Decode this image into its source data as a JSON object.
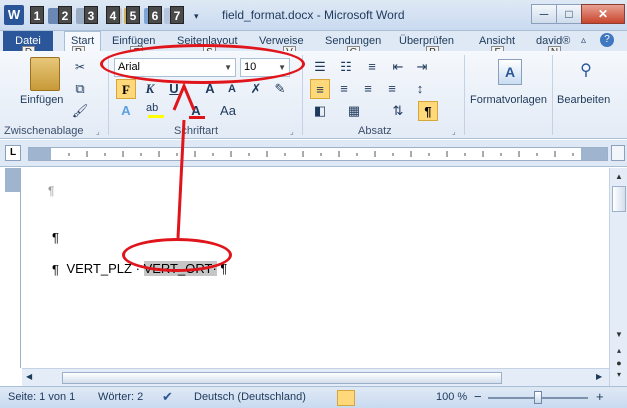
{
  "window": {
    "title": "field_format.docx - Microsoft Word",
    "app_logo": "W",
    "minimize": "─",
    "maximize": "□",
    "close": "✕"
  },
  "qat": {
    "key_tips": [
      "1",
      "2",
      "3",
      "4",
      "5",
      "6",
      "7"
    ]
  },
  "tabs": {
    "file": "Datei",
    "items": [
      "Start",
      "Einfügen",
      "Seitenlayout",
      "Verweise",
      "Sendungen",
      "Überprüfen",
      "Ansicht",
      "david®"
    ],
    "active": "Start"
  },
  "key_tips": {
    "file": "D",
    "start": "R",
    "font_name": "F",
    "font_size": "S",
    "font_size2": "V",
    "sendungen": "G",
    "ueberpruefen": "P",
    "formatvorlagen": "F",
    "bearbeiten": "N"
  },
  "ribbon": {
    "clipboard": {
      "paste_label": "Einfügen",
      "group_label": "Zwischenablage"
    },
    "font": {
      "font_name": "Arial",
      "font_size": "10",
      "bold": "F",
      "italic": "K",
      "underline": "U",
      "grow": "A",
      "shrink": "A",
      "change_case": "Aa",
      "group_label": "Schriftart"
    },
    "paragraph": {
      "group_label": "Absatz",
      "show_marks": "¶"
    },
    "styles": {
      "label": "Formatvorlagen"
    },
    "editing": {
      "label": "Bearbeiten"
    }
  },
  "document": {
    "line1": "¶",
    "line2": "¶",
    "field1": "VERT_PLZ",
    "middle_dot": "·",
    "field2": "VERT_ORT",
    "pilcrow_end": "¶",
    "line4": "¶"
  },
  "status": {
    "page": "Seite: 1 von 1",
    "words": "Wörter: 2",
    "language": "Deutsch (Deutschland)",
    "zoom": "100 %",
    "zoom_minus": "−",
    "zoom_plus": "+",
    "zoom_level": 1.0
  },
  "colors": {
    "annotation": "#e0141b",
    "file_tab": "#2b579a",
    "field_highlight": "#c6c6c6"
  }
}
